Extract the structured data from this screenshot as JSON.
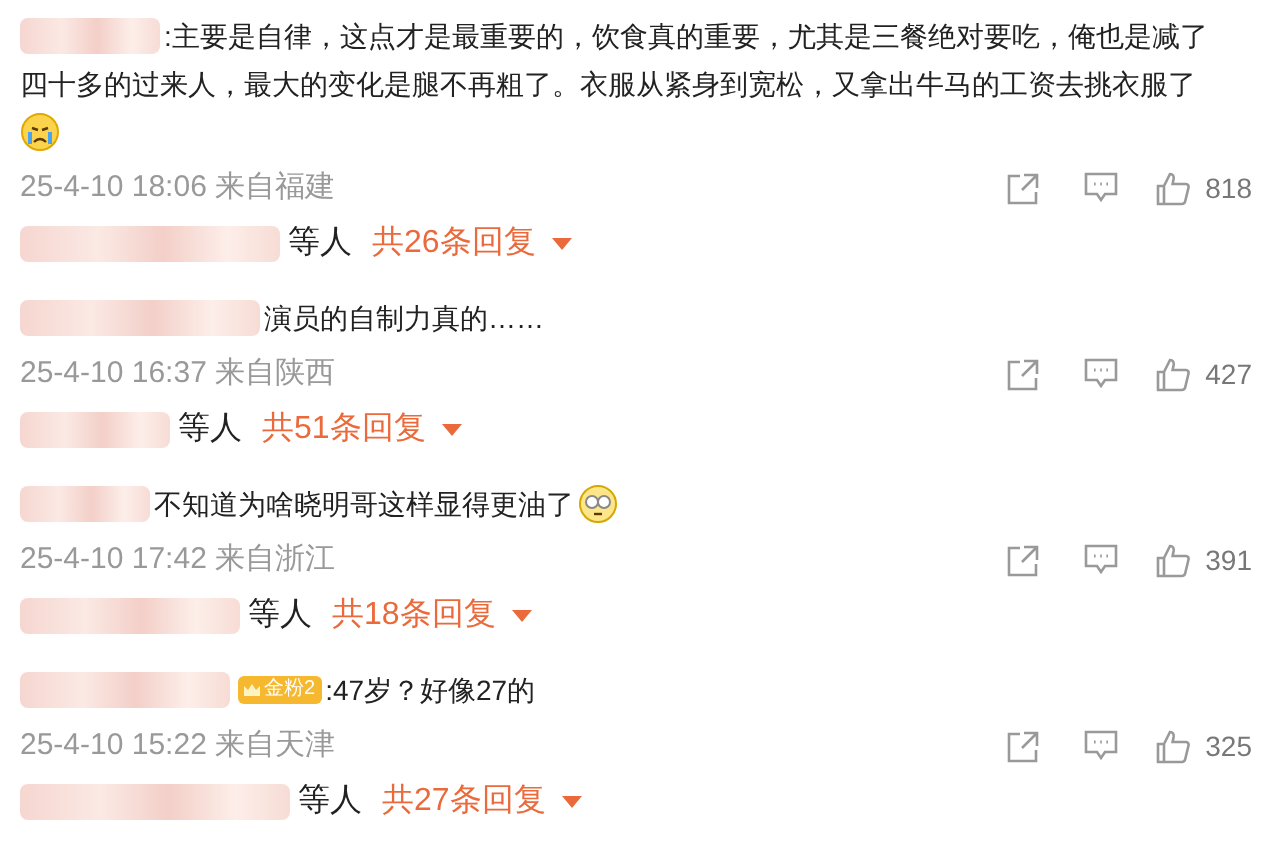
{
  "comments": [
    {
      "lines": [
        ":主要是自律，这点才是最重要的，饮食真的重要，尤其是三餐绝对要吃，俺也是减了",
        "四十多的过来人，最大的变化是腿不再粗了。衣服从紧身到宽松，又拿出牛马的工资去挑衣服了"
      ],
      "emoji": {
        "kind": "crying"
      },
      "date": "25-4-10 18:06",
      "location": "来自福建",
      "likes": "818",
      "replies_by": "等人",
      "replies": "共26条回复"
    },
    {
      "lines": [
        "演员的自制力真的……"
      ],
      "date": "25-4-10 16:37",
      "location": "来自陕西",
      "likes": "427",
      "replies_by": "等人",
      "replies": "共51条回复"
    },
    {
      "lines": [
        "不知道为啥晓明哥这样显得更油了"
      ],
      "emoji": {
        "kind": "dizzy"
      },
      "date": "25-4-10 17:42",
      "location": "来自浙江",
      "likes": "391",
      "replies_by": "等人",
      "replies": "共18条回复"
    },
    {
      "badge": "金粉2",
      "lines": [
        ":47岁？好像27的"
      ],
      "date": "25-4-10 15:22",
      "location": "来自天津",
      "likes": "325",
      "replies_by": "等人",
      "replies": "共27条回复"
    }
  ]
}
